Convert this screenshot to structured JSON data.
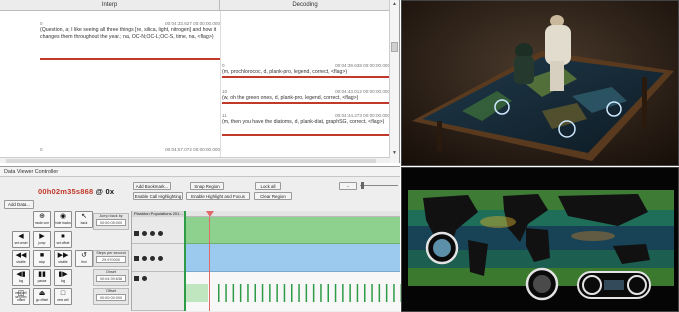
{
  "coding": {
    "headers": [
      "Interp",
      "Decoding"
    ],
    "interp_rows": [
      {
        "id": "0",
        "time": "00:04:33.627  00:00:00.000",
        "text": "(Question, a; I like seeing all three things [re, silica, light, nitrogen] and how it changes them throughout the year.; na, OC-N;OC-L;OC-S, time, na, <flag>)"
      },
      {
        "id": "0",
        "time": "00:04:57.072  00:00:00.000",
        "text": ""
      }
    ],
    "decoding_rows": [
      {
        "id": "0",
        "time": "00:04:39.638  00:00:00.000",
        "text": "(m, prochlorococ, d, plank-pro, legend, correct, <flag>)"
      },
      {
        "id": "10",
        "time": "00:04:43.012  00:00:00.000",
        "text": "(w, oh the green ones, d, plank-pro, legend, correct, <flag>)"
      },
      {
        "id": "11",
        "time": "00:04:44.273  00:00:00.000",
        "text": "(m, then you have the diatoms, d, plank-diat, graphSG, correct, <flag>)"
      }
    ]
  },
  "dvc": {
    "title": "Data Viewer Controller",
    "timecode_red": "00h02m35s868",
    "timecode_black": "@ 0x",
    "add_data": "Add Data...",
    "buttons": {
      "add_bookmark": "Add Bookmark...",
      "snap_region": "Snap Region",
      "lock_all": "Lock all",
      "enable_call_highlighting": "Enable Call Highlighting",
      "enable_highlight_focus": "Enable Highlight and Focus",
      "clear_region": "Clear Region"
    },
    "controls": [
      {
        "glyph": "⊕",
        "label": "mode\ncurr"
      },
      {
        "glyph": "◉",
        "label": "hide\ntracks"
      },
      {
        "glyph": "↖",
        "label": "back"
      },
      {
        "glyph": "◀",
        "label": "set\nonset"
      },
      {
        "glyph": "▶",
        "label": "jump"
      },
      {
        "glyph": "⏹",
        "label": "set\noffset"
      },
      {
        "glyph": "◀◀",
        "label": "shuttle"
      },
      {
        "glyph": "■",
        "label": "stop"
      },
      {
        "glyph": "▶▶",
        "label": "shuttle"
      },
      {
        "glyph": "↺",
        "label": "find"
      },
      {
        "glyph": "◀▮",
        "label": "log"
      },
      {
        "glyph": "▮▮",
        "label": "pause"
      },
      {
        "glyph": "▮▶",
        "label": "log"
      },
      {
        "glyph": "◫",
        "label": "new cell\nset prev offset"
      },
      {
        "glyph": "⏏",
        "label": "go\noffset"
      },
      {
        "glyph": "□",
        "label": "new\ncell"
      }
    ],
    "jump_back": {
      "caption": "Jump back by",
      "value": "00:00:05:000"
    },
    "steps": {
      "caption": "Steps per second",
      "value": "29.970000"
    },
    "onset": {
      "caption": "Onset",
      "value": "00:04:39:638"
    },
    "offset": {
      "caption": "Offset",
      "value": "00:00:00:000"
    },
    "track_name": "Plankton Populations 201...",
    "zoom_value": "−"
  },
  "colors": {
    "red_accent": "#c0392b",
    "track_green": "#8ed08e",
    "track_blue": "#9cc9ee",
    "marker_green": "#2e9c47"
  }
}
